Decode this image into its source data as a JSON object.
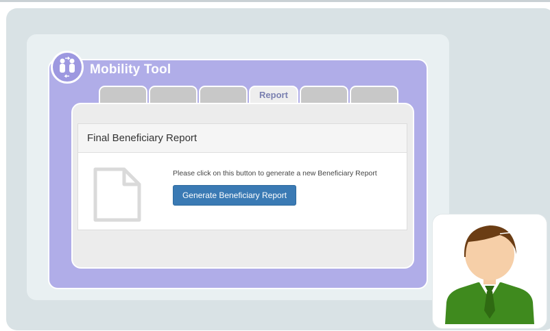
{
  "app": {
    "title": "Mobility Tool",
    "logo_icon": "two-people-exchange-icon"
  },
  "tabs": [
    {
      "label": "",
      "active": false
    },
    {
      "label": "",
      "active": false
    },
    {
      "label": "",
      "active": false
    },
    {
      "label": "Report",
      "active": true
    },
    {
      "label": "",
      "active": false
    },
    {
      "label": "",
      "active": false
    }
  ],
  "report": {
    "title": "Final Beneficiary Report",
    "instruction": "Please click on this button to generate a new Beneficiary Report",
    "button_label": "Generate Beneficiary Report",
    "icon": "document-icon"
  },
  "avatar": {
    "icon": "user-avatar-icon"
  },
  "colors": {
    "window": "#b0ade8",
    "logo": "#9d98e0",
    "button": "#3a7ab4",
    "canvas": "#d9e2e5",
    "panel": "#e9f0f2"
  }
}
